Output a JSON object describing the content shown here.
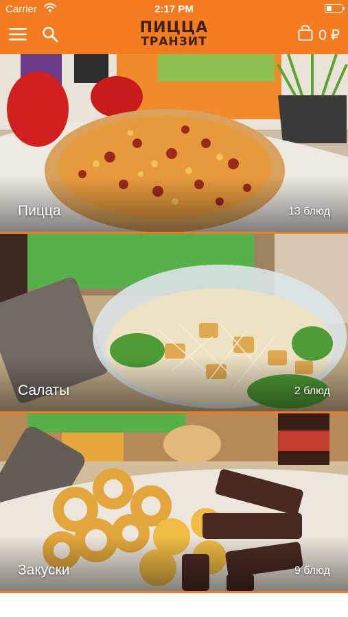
{
  "status_bar": {
    "carrier": "Carrier",
    "time": "2:17 PM",
    "battery_level": 0.35
  },
  "header": {
    "logo_line1": "ПИЦЦА",
    "logo_line2": "ТРАНЗИТ",
    "cart_total": "0 ₽",
    "icons": [
      "menu-icon",
      "search-icon",
      "cart-icon"
    ]
  },
  "colors": {
    "accent": "#f47b20",
    "logo": "#3b2314"
  },
  "categories": [
    {
      "name": "Пицца",
      "count": "13 блюд"
    },
    {
      "name": "Салаты",
      "count": "2 блюд"
    },
    {
      "name": "Закуски",
      "count": "9 блюд"
    }
  ]
}
